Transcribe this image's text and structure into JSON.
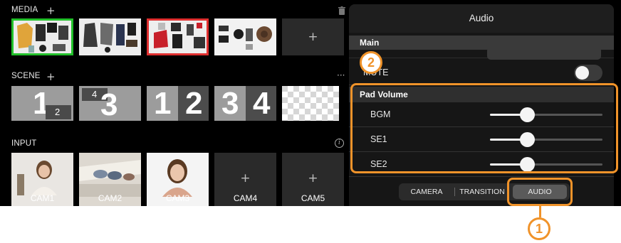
{
  "media": {
    "label": "MEDIA",
    "add_icon": "plus-icon",
    "delete_icon": "trash-icon",
    "add_tile_icon": "plus-icon"
  },
  "scene": {
    "label": "SCENE",
    "add_icon": "plus-icon",
    "more_icon": "ellipsis-icon",
    "tiles": [
      {
        "main": "1",
        "sub": "2"
      },
      {
        "main": "3",
        "sub": "4"
      },
      {
        "main": "1",
        "sub": "2"
      },
      {
        "main": "3",
        "sub": "4"
      }
    ]
  },
  "input": {
    "label": "INPUT",
    "info_icon": "info-icon",
    "cams": [
      "CAM1",
      "CAM2",
      "CAM3",
      "CAM4",
      "CAM5"
    ]
  },
  "panel": {
    "title": "Audio",
    "main_header": "Main",
    "mute_label": "MUTE",
    "pad_header": "Pad Volume",
    "pad_rows": [
      {
        "label": "BGM",
        "level": 0.33
      },
      {
        "label": "SE1",
        "level": 0.33
      },
      {
        "label": "SE2",
        "level": 0.33
      }
    ],
    "mute_on": false
  },
  "tabs": [
    "CAMERA",
    "TRANSITION",
    "AUDIO"
  ],
  "active_tab": "AUDIO",
  "callouts": [
    "1",
    "2"
  ],
  "colors": {
    "accent_callout": "#f0932a",
    "selected_green": "#22c02a",
    "selected_red": "#e03030"
  }
}
